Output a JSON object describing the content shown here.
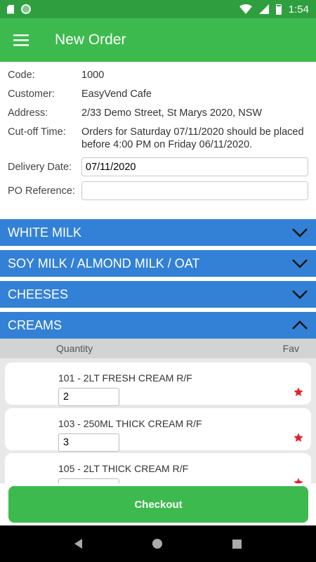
{
  "status_bar": {
    "time": "1:54"
  },
  "app_bar": {
    "title": "New Order"
  },
  "order": {
    "code_label": "Code:",
    "code_value": "1000",
    "customer_label": "Customer:",
    "customer_value": "EasyVend Cafe",
    "address_label": "Address:",
    "address_value": "2/33 Demo Street, St Marys 2020, NSW",
    "cutoff_label": "Cut-off Time:",
    "cutoff_value": "Orders for Saturday 07/11/2020 should be placed before 4:00 PM on Friday 06/11/2020.",
    "delivery_label": "Delivery Date:",
    "delivery_value": "07/11/2020",
    "po_label": "PO Reference:",
    "po_value": ""
  },
  "categories": [
    {
      "label": "WHITE MILK",
      "expanded": false
    },
    {
      "label": "SOY MILK / ALMOND MILK / OAT",
      "expanded": false
    },
    {
      "label": "CHEESES",
      "expanded": false
    },
    {
      "label": "CREAMS",
      "expanded": true
    }
  ],
  "list_header": {
    "quantity": "Quantity",
    "fav": "Fav"
  },
  "items": [
    {
      "name": "101 - 2LT FRESH CREAM R/F",
      "qty": "2",
      "fav": true
    },
    {
      "name": "103 - 250ML THICK CREAM R/F",
      "qty": "3",
      "fav": true
    },
    {
      "name": "105 - 2LT THICK CREAM R/F",
      "qty": "",
      "fav": true
    }
  ],
  "checkout_label": "Checkout",
  "colors": {
    "primary": "#3dba4e",
    "status": "#2e9e3e",
    "category": "#3381d6",
    "star": "#e8202a"
  }
}
